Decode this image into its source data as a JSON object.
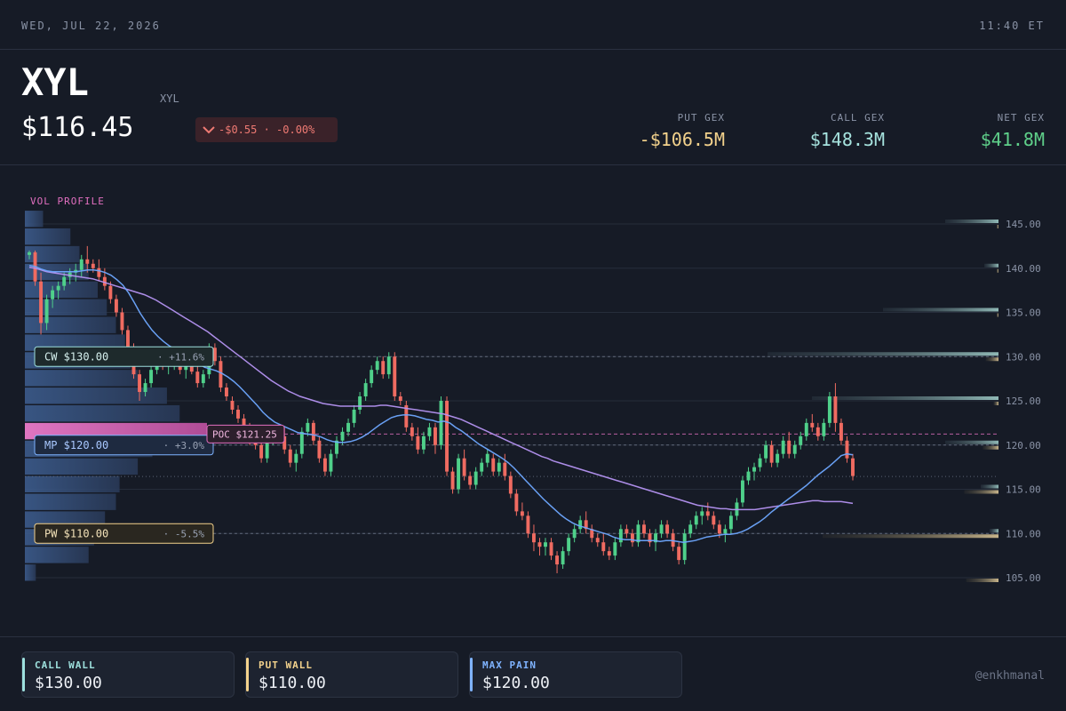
{
  "topbar": {
    "date": "WED, JUL 22, 2026",
    "time": "11:40 ET"
  },
  "header": {
    "ticker": "XYL",
    "ticker_sub": "XYL",
    "price": "$116.45",
    "change": "-$0.55 · -0.00%",
    "change_direction_icon": "chevron-down-icon",
    "put_gex": {
      "label": "PUT GEX",
      "value": "-$106.5M"
    },
    "call_gex": {
      "label": "CALL GEX",
      "value": "$148.3M"
    },
    "net_gex": {
      "label": "NET GEX",
      "value": "$41.8M"
    }
  },
  "colors": {
    "background": "#161b26",
    "up": "#4fd08a",
    "down": "#ef6b61",
    "call_wall": "#9de0dd",
    "put_wall": "#f3d28c",
    "max_pain": "#7fb3ff",
    "poc": "#e26fc0",
    "ma_fast": "#6ea8ff",
    "ma_slow": "#b593f2",
    "put_gex": "#f3d28c",
    "call_gex": "#a6e3de",
    "net_gex": "#5fd08a"
  },
  "chart_data": {
    "type": "candlestick",
    "ylim": [
      103,
      148
    ],
    "y_ticks": [
      "145.00",
      "140.00",
      "135.00",
      "130.00",
      "125.00",
      "120.00",
      "115.00",
      "110.00",
      "105.00"
    ],
    "vol_profile_label": "VOL PROFILE",
    "candles": [
      [
        141.5,
        142.0,
        141.0,
        141.8
      ],
      [
        141.8,
        142.0,
        138.0,
        138.5
      ],
      [
        138.5,
        139.5,
        132.5,
        133.8
      ],
      [
        133.8,
        137.0,
        133.0,
        136.5
      ],
      [
        136.5,
        138.0,
        135.5,
        137.5
      ],
      [
        137.5,
        138.5,
        136.5,
        138.0
      ],
      [
        138.0,
        139.5,
        137.5,
        139.0
      ],
      [
        139.0,
        140.0,
        138.2,
        139.5
      ],
      [
        139.5,
        140.5,
        138.5,
        139.8
      ],
      [
        139.8,
        141.5,
        139.0,
        141.0
      ],
      [
        141.0,
        142.5,
        139.5,
        140.5
      ],
      [
        140.5,
        141.0,
        139.5,
        140.0
      ],
      [
        140.0,
        141.0,
        138.5,
        139.0
      ],
      [
        139.0,
        140.0,
        137.5,
        138.0
      ],
      [
        138.0,
        138.5,
        136.0,
        136.5
      ],
      [
        136.5,
        137.0,
        134.5,
        135.0
      ],
      [
        135.0,
        135.5,
        132.5,
        133.0
      ],
      [
        133.0,
        133.5,
        130.0,
        131.0
      ],
      [
        131.0,
        131.5,
        127.5,
        128.0
      ],
      [
        128.0,
        128.5,
        125.0,
        126.0
      ],
      [
        126.0,
        127.5,
        125.5,
        127.0
      ],
      [
        127.0,
        129.0,
        126.5,
        128.5
      ],
      [
        128.5,
        130.0,
        128.0,
        129.5
      ],
      [
        129.5,
        130.5,
        128.5,
        129.0
      ],
      [
        129.0,
        130.0,
        128.0,
        129.5
      ],
      [
        129.5,
        130.5,
        128.5,
        130.0
      ],
      [
        130.0,
        131.0,
        128.0,
        128.5
      ],
      [
        128.5,
        129.5,
        127.5,
        129.0
      ],
      [
        129.0,
        130.0,
        128.0,
        128.3
      ],
      [
        128.3,
        129.0,
        126.5,
        127.0
      ],
      [
        127.0,
        128.5,
        126.5,
        128.0
      ],
      [
        128.0,
        131.5,
        127.5,
        131.0
      ],
      [
        131.0,
        131.5,
        129.0,
        129.5
      ],
      [
        129.5,
        130.0,
        126.0,
        126.5
      ],
      [
        126.5,
        127.0,
        125.0,
        125.5
      ],
      [
        125.0,
        125.5,
        123.5,
        124.0
      ],
      [
        124.0,
        124.5,
        122.5,
        123.0
      ],
      [
        123.0,
        123.5,
        121.5,
        122.0
      ],
      [
        122.0,
        122.5,
        120.0,
        120.5
      ],
      [
        120.5,
        121.0,
        119.5,
        120.0
      ],
      [
        120.0,
        120.5,
        118.0,
        118.5
      ],
      [
        118.5,
        121.0,
        118.0,
        120.5
      ],
      [
        120.5,
        122.0,
        120.0,
        121.5
      ],
      [
        121.5,
        122.0,
        120.5,
        121.0
      ],
      [
        121.0,
        122.0,
        119.0,
        119.5
      ],
      [
        119.5,
        120.0,
        117.5,
        118.0
      ],
      [
        118.0,
        119.5,
        117.0,
        119.0
      ],
      [
        119.0,
        122.0,
        118.5,
        121.5
      ],
      [
        121.5,
        123.0,
        121.0,
        122.5
      ],
      [
        122.5,
        122.8,
        120.0,
        120.5
      ],
      [
        120.5,
        121.0,
        118.0,
        118.5
      ],
      [
        118.5,
        119.0,
        116.5,
        117.0
      ],
      [
        117.0,
        119.5,
        116.5,
        119.0
      ],
      [
        119.0,
        121.0,
        118.5,
        120.5
      ],
      [
        120.5,
        122.0,
        120.0,
        121.5
      ],
      [
        121.5,
        123.0,
        121.0,
        122.5
      ],
      [
        122.5,
        124.5,
        122.0,
        124.0
      ],
      [
        124.0,
        126.0,
        123.5,
        125.5
      ],
      [
        125.5,
        127.5,
        125.0,
        127.0
      ],
      [
        127.0,
        129.0,
        126.5,
        128.5
      ],
      [
        128.5,
        130.0,
        128.0,
        129.5
      ],
      [
        129.5,
        130.0,
        127.5,
        128.0
      ],
      [
        128.0,
        130.5,
        127.5,
        130.0
      ],
      [
        130.0,
        130.5,
        125.0,
        125.5
      ],
      [
        125.5,
        126.0,
        124.5,
        125.0
      ],
      [
        124.5,
        125.0,
        121.5,
        122.0
      ],
      [
        122.0,
        122.5,
        120.5,
        121.0
      ],
      [
        121.0,
        122.0,
        119.0,
        119.5
      ],
      [
        119.5,
        121.5,
        119.0,
        121.0
      ],
      [
        121.0,
        122.5,
        120.5,
        122.0
      ],
      [
        122.0,
        122.5,
        119.0,
        120.0
      ],
      [
        120.0,
        125.5,
        119.5,
        125.0
      ],
      [
        125.0,
        125.5,
        116.5,
        117.0
      ],
      [
        117.0,
        117.5,
        114.5,
        115.0
      ],
      [
        115.0,
        119.0,
        114.5,
        118.5
      ],
      [
        118.5,
        119.5,
        116.0,
        116.5
      ],
      [
        116.5,
        117.0,
        115.0,
        115.5
      ],
      [
        115.5,
        117.5,
        115.0,
        117.0
      ],
      [
        117.0,
        118.5,
        116.5,
        118.0
      ],
      [
        118.0,
        119.5,
        117.5,
        119.0
      ],
      [
        118.5,
        119.0,
        116.5,
        117.0
      ],
      [
        117.0,
        118.5,
        116.5,
        118.0
      ],
      [
        118.0,
        119.0,
        116.0,
        116.5
      ],
      [
        116.5,
        117.0,
        114.0,
        114.5
      ],
      [
        114.5,
        115.0,
        112.0,
        112.5
      ],
      [
        112.5,
        113.5,
        111.5,
        112.0
      ],
      [
        112.0,
        112.5,
        109.5,
        110.0
      ],
      [
        110.0,
        111.0,
        108.0,
        109.0
      ],
      [
        109.0,
        109.5,
        107.5,
        108.5
      ],
      [
        108.5,
        109.5,
        107.5,
        109.0
      ],
      [
        109.0,
        109.5,
        107.0,
        107.5
      ],
      [
        107.5,
        108.0,
        105.5,
        106.5
      ],
      [
        106.5,
        108.5,
        106.0,
        108.0
      ],
      [
        108.0,
        110.0,
        107.5,
        109.5
      ],
      [
        109.5,
        111.0,
        109.0,
        110.5
      ],
      [
        110.5,
        112.0,
        110.0,
        111.5
      ],
      [
        111.5,
        112.5,
        110.0,
        110.5
      ],
      [
        110.5,
        111.0,
        109.0,
        109.5
      ],
      [
        109.5,
        110.0,
        108.5,
        109.0
      ],
      [
        109.0,
        110.0,
        107.5,
        108.0
      ],
      [
        108.0,
        108.5,
        107.0,
        107.5
      ],
      [
        107.5,
        109.5,
        107.0,
        109.0
      ],
      [
        109.0,
        111.0,
        108.5,
        110.5
      ],
      [
        110.5,
        111.0,
        109.5,
        110.0
      ],
      [
        110.0,
        110.5,
        108.5,
        109.0
      ],
      [
        109.0,
        111.5,
        108.5,
        111.0
      ],
      [
        111.0,
        111.5,
        109.5,
        110.0
      ],
      [
        110.0,
        110.5,
        108.5,
        109.0
      ],
      [
        109.0,
        110.5,
        108.0,
        110.0
      ],
      [
        110.0,
        111.5,
        109.5,
        111.0
      ],
      [
        111.0,
        111.5,
        109.5,
        110.0
      ],
      [
        110.0,
        110.5,
        108.0,
        108.5
      ],
      [
        108.5,
        109.0,
        106.5,
        107.0
      ],
      [
        107.0,
        110.5,
        106.5,
        110.0
      ],
      [
        110.0,
        111.5,
        109.5,
        111.0
      ],
      [
        111.0,
        112.5,
        110.5,
        112.0
      ],
      [
        112.0,
        113.0,
        111.0,
        112.5
      ],
      [
        112.5,
        113.5,
        111.5,
        112.0
      ],
      [
        112.0,
        112.5,
        110.5,
        111.0
      ],
      [
        111.0,
        111.5,
        109.5,
        110.0
      ],
      [
        110.0,
        111.0,
        109.0,
        110.5
      ],
      [
        110.5,
        112.5,
        110.0,
        112.0
      ],
      [
        112.0,
        114.0,
        111.5,
        113.5
      ],
      [
        113.5,
        116.5,
        113.0,
        116.0
      ],
      [
        116.0,
        117.5,
        115.5,
        117.0
      ],
      [
        117.0,
        118.0,
        116.0,
        117.5
      ],
      [
        117.5,
        119.0,
        117.0,
        118.5
      ],
      [
        118.5,
        120.5,
        118.0,
        120.0
      ],
      [
        120.0,
        120.5,
        117.5,
        118.0
      ],
      [
        118.0,
        119.5,
        117.5,
        119.0
      ],
      [
        119.0,
        121.0,
        118.5,
        120.5
      ],
      [
        120.5,
        121.5,
        118.5,
        119.0
      ],
      [
        119.0,
        120.5,
        118.5,
        120.0
      ],
      [
        120.0,
        121.5,
        119.5,
        121.0
      ],
      [
        121.0,
        123.0,
        120.5,
        122.5
      ],
      [
        122.5,
        123.5,
        121.5,
        122.0
      ],
      [
        122.0,
        122.5,
        120.5,
        121.0
      ],
      [
        121.0,
        123.0,
        120.5,
        122.5
      ],
      [
        122.5,
        126.0,
        122.0,
        125.5
      ],
      [
        125.5,
        127.0,
        121.5,
        122.5
      ],
      [
        122.5,
        123.0,
        120.0,
        120.5
      ],
      [
        120.5,
        121.0,
        118.0,
        118.5
      ],
      [
        118.5,
        119.0,
        116.0,
        116.5
      ]
    ],
    "ma_fast": [
      140.3,
      140.2,
      139.9,
      139.7,
      139.6,
      139.6,
      139.6,
      139.6,
      139.6,
      139.7,
      139.8,
      139.8,
      139.7,
      139.5,
      139.2,
      138.7,
      138.1,
      137.2,
      136.1,
      134.9,
      133.9,
      133.0,
      132.3,
      131.7,
      131.2,
      130.8,
      130.4,
      130.0,
      129.6,
      129.2,
      128.8,
      128.6,
      128.4,
      128.1,
      127.7,
      127.2,
      126.6,
      125.9,
      125.2,
      124.5,
      123.7,
      123.1,
      122.6,
      122.3,
      122.0,
      121.7,
      121.4,
      121.3,
      121.2,
      121.1,
      120.9,
      120.6,
      120.4,
      120.3,
      120.3,
      120.4,
      120.6,
      120.9,
      121.3,
      121.8,
      122.3,
      122.7,
      123.1,
      123.3,
      123.4,
      123.4,
      123.3,
      123.1,
      122.9,
      122.8,
      122.6,
      122.7,
      122.5,
      122.0,
      121.6,
      121.1,
      120.6,
      120.1,
      119.7,
      119.3,
      118.9,
      118.5,
      118.0,
      117.4,
      116.7,
      116.0,
      115.3,
      114.6,
      113.9,
      113.3,
      112.7,
      112.1,
      111.6,
      111.2,
      110.9,
      110.7,
      110.5,
      110.3,
      110.1,
      109.9,
      109.6,
      109.4,
      109.3,
      109.3,
      109.2,
      109.2,
      109.2,
      109.2,
      109.1,
      109.2,
      109.2,
      109.1,
      109.0,
      109.1,
      109.2,
      109.4,
      109.6,
      109.7,
      109.8,
      109.9,
      109.9,
      110.0,
      110.2,
      110.5,
      110.9,
      111.3,
      111.8,
      112.4,
      112.9,
      113.4,
      113.9,
      114.4,
      114.9,
      115.4,
      116.0,
      116.6,
      117.1,
      117.6,
      118.2,
      118.8,
      119.0,
      118.9
    ],
    "ma_slow": [
      140.1,
      140.0,
      139.8,
      139.6,
      139.5,
      139.4,
      139.3,
      139.2,
      139.1,
      139.0,
      138.9,
      138.8,
      138.6,
      138.4,
      138.2,
      138.0,
      137.8,
      137.6,
      137.4,
      137.2,
      137.0,
      136.7,
      136.4,
      136.0,
      135.6,
      135.2,
      134.8,
      134.4,
      134.0,
      133.6,
      133.2,
      132.8,
      132.3,
      131.8,
      131.3,
      130.8,
      130.3,
      129.8,
      129.3,
      128.8,
      128.3,
      127.8,
      127.3,
      126.9,
      126.5,
      126.1,
      125.8,
      125.5,
      125.3,
      125.1,
      124.9,
      124.7,
      124.6,
      124.5,
      124.4,
      124.4,
      124.4,
      124.4,
      124.4,
      124.4,
      124.4,
      124.5,
      124.5,
      124.4,
      124.3,
      124.2,
      124.1,
      124.0,
      123.9,
      123.8,
      123.7,
      123.6,
      123.5,
      123.3,
      123.1,
      122.9,
      122.6,
      122.3,
      122.0,
      121.7,
      121.4,
      121.1,
      120.8,
      120.5,
      120.2,
      119.9,
      119.6,
      119.3,
      119.0,
      118.7,
      118.5,
      118.2,
      118.0,
      117.8,
      117.6,
      117.4,
      117.2,
      117.0,
      116.8,
      116.6,
      116.4,
      116.2,
      116.0,
      115.8,
      115.6,
      115.4,
      115.2,
      115.0,
      114.8,
      114.6,
      114.4,
      114.2,
      114.0,
      113.8,
      113.6,
      113.4,
      113.2,
      113.1,
      113.0,
      112.9,
      112.8,
      112.8,
      112.7,
      112.7,
      112.7,
      112.7,
      112.7,
      112.8,
      112.9,
      113.0,
      113.1,
      113.2,
      113.3,
      113.4,
      113.5,
      113.6,
      113.7,
      113.7,
      113.6,
      113.6,
      113.6,
      113.6,
      113.5,
      113.4
    ],
    "vol_profile": [
      {
        "price": 145.5,
        "vol": 0.1
      },
      {
        "price": 143.5,
        "vol": 0.25
      },
      {
        "price": 141.5,
        "vol": 0.3
      },
      {
        "price": 139.5,
        "vol": 0.35
      },
      {
        "price": 137.5,
        "vol": 0.4
      },
      {
        "price": 135.5,
        "vol": 0.45
      },
      {
        "price": 133.5,
        "vol": 0.5
      },
      {
        "price": 131.5,
        "vol": 0.55
      },
      {
        "price": 129.5,
        "vol": 0.58
      },
      {
        "price": 127.5,
        "vol": 0.62
      },
      {
        "price": 125.5,
        "vol": 0.78
      },
      {
        "price": 123.5,
        "vol": 0.85
      },
      {
        "price": 121.5,
        "vol": 1.0,
        "poc": true
      },
      {
        "price": 119.5,
        "vol": 0.7
      },
      {
        "price": 117.5,
        "vol": 0.62
      },
      {
        "price": 115.5,
        "vol": 0.52
      },
      {
        "price": 113.5,
        "vol": 0.5
      },
      {
        "price": 111.5,
        "vol": 0.44
      },
      {
        "price": 109.5,
        "vol": 0.38
      },
      {
        "price": 107.5,
        "vol": 0.35
      },
      {
        "price": 105.5,
        "vol": 0.06
      }
    ],
    "gex_bars": [
      {
        "strike": 145,
        "call": 0.3,
        "put": 0.02
      },
      {
        "strike": 140,
        "call": 0.08,
        "put": 0.02
      },
      {
        "strike": 135,
        "call": 0.65,
        "put": 0.02
      },
      {
        "strike": 130,
        "call": 1.3,
        "put": 0.13
      },
      {
        "strike": 125,
        "call": 1.05,
        "put": 0.05
      },
      {
        "strike": 120,
        "call": 0.3,
        "put": 0.16
      },
      {
        "strike": 115,
        "call": 0.1,
        "put": 0.35
      },
      {
        "strike": 110,
        "call": 0.05,
        "put": 1.8
      },
      {
        "strike": 105,
        "call": 0.0,
        "put": 0.33
      }
    ],
    "levels": [
      {
        "key": "cw",
        "label": "CW $130.00",
        "pct": "+11.6%",
        "price": 130.0,
        "color": "#9de0dd"
      },
      {
        "key": "mp",
        "label": "MP $120.00",
        "pct": "+3.0%",
        "price": 120.0,
        "color": "#7fb3ff"
      },
      {
        "key": "pw",
        "label": "PW $110.00",
        "pct": "-5.5%",
        "price": 110.0,
        "color": "#f3d28c"
      }
    ],
    "poc": {
      "label": "POC $121.25",
      "price": 121.25
    },
    "current_price": 116.45
  },
  "footer": {
    "call_wall": {
      "label": "CALL WALL",
      "value": "$130.00"
    },
    "put_wall": {
      "label": "PUT WALL",
      "value": "$110.00"
    },
    "max_pain": {
      "label": "MAX PAIN",
      "value": "$120.00"
    },
    "handle": "@enkhmanal"
  }
}
